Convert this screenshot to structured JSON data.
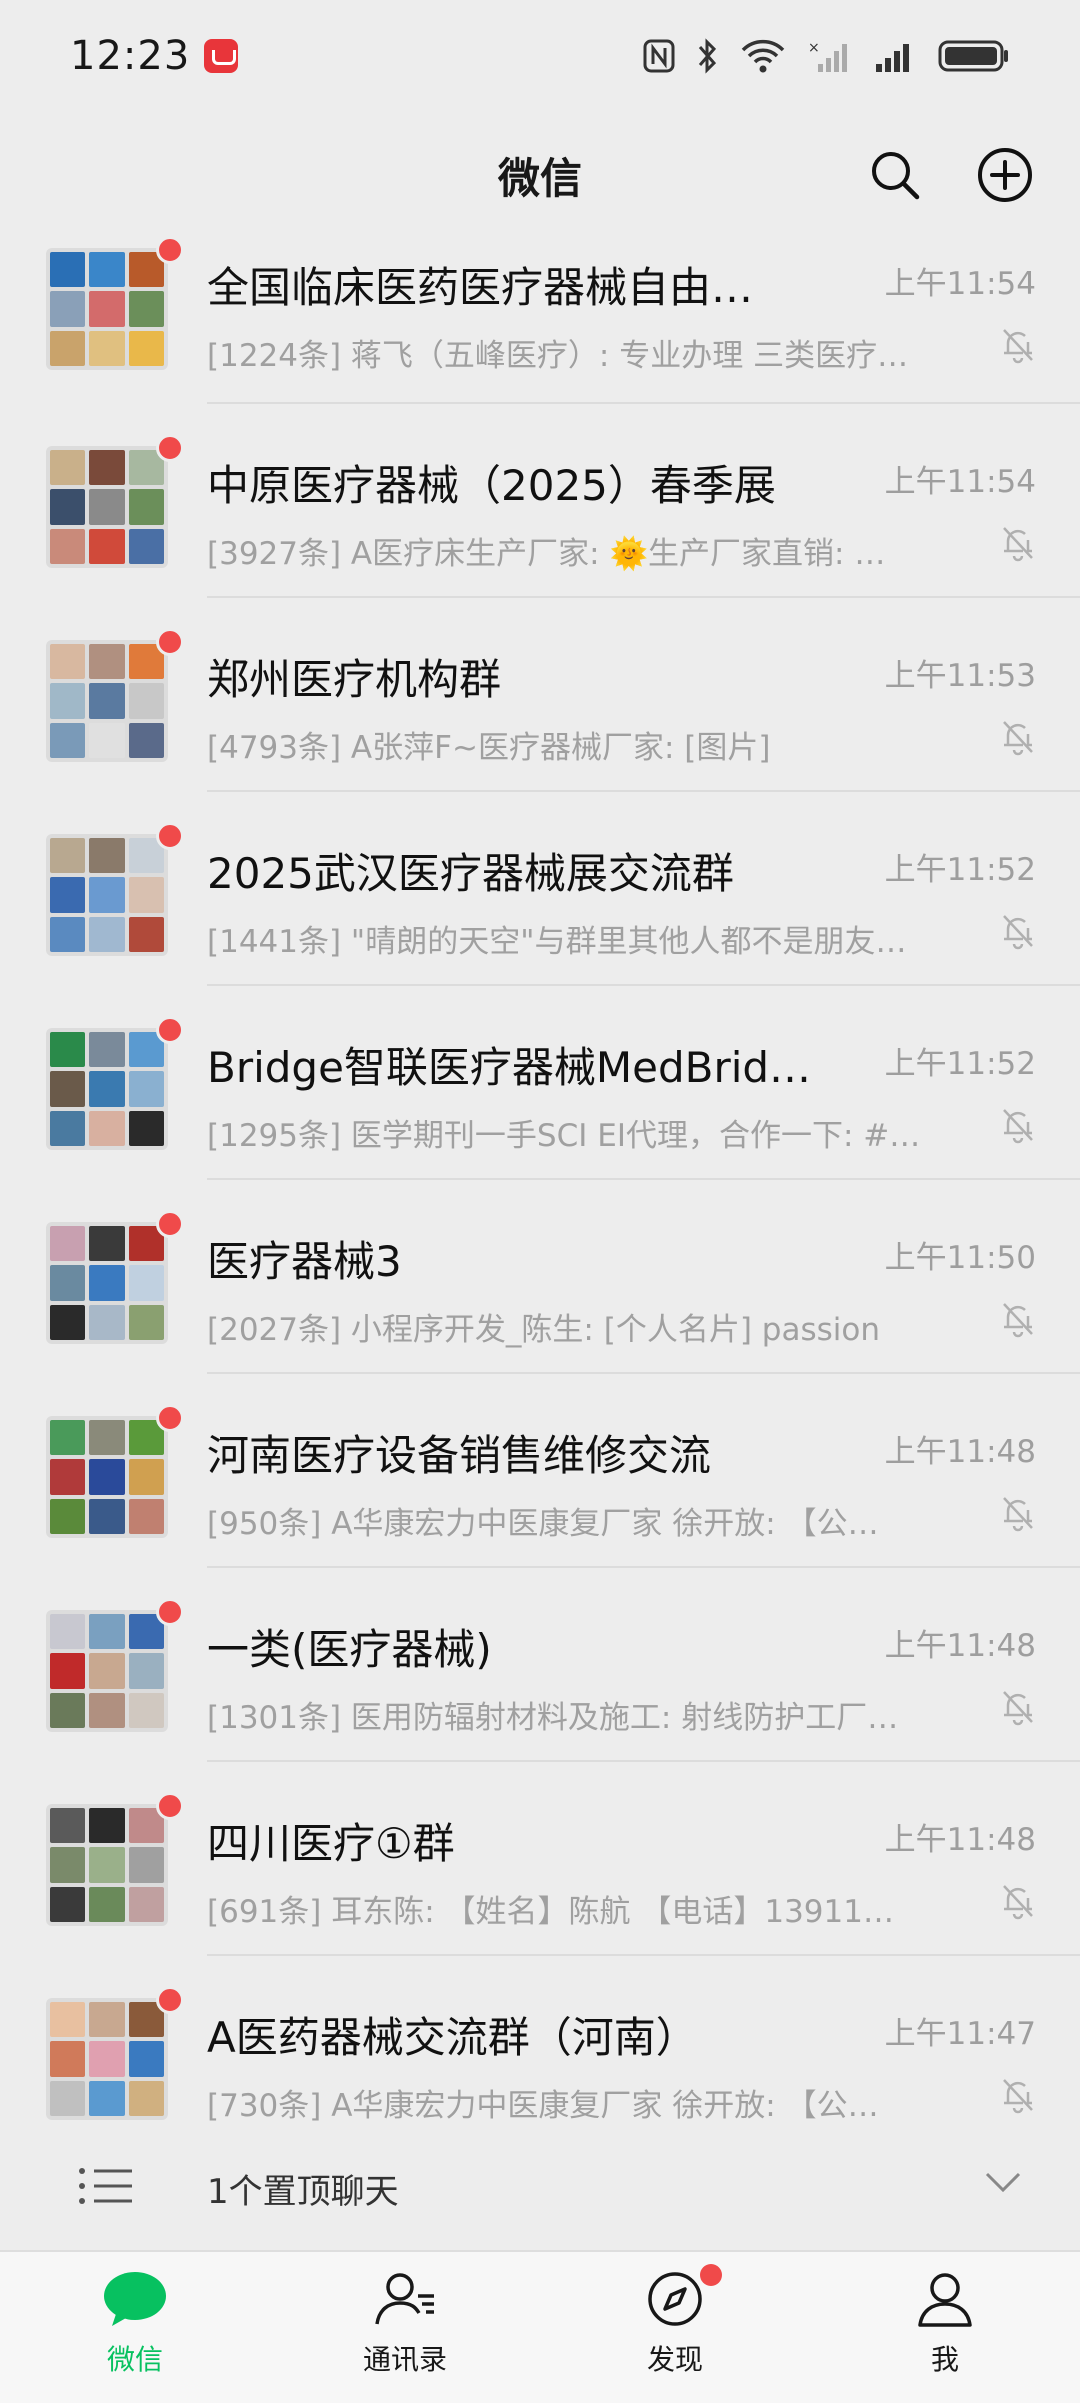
{
  "status_bar": {
    "time": "12:23"
  },
  "header": {
    "title": "微信"
  },
  "chats": [
    {
      "name": "全国临床医药医疗器械自由…",
      "time": "上午11:54",
      "preview": "[1224条] 蒋飞（五峰医疗）: 专业办理 三类医疗…",
      "avatar_colors": [
        "#2a6fb5",
        "#3a86c9",
        "#b85a2a",
        "#8aa0b8",
        "#d36b6b",
        "#6b8f5a",
        "#c9a36b",
        "#e0c080",
        "#e9b84a"
      ]
    },
    {
      "name": "中原医疗器械（2025）春季展",
      "time": "上午11:54",
      "preview": "[3927条] A医疗床生产厂家: 🌞生产厂家直销: …",
      "avatar_colors": [
        "#c9b08a",
        "#7a4a3a",
        "#a7b8a0",
        "#3b4f6b",
        "#8a8a8a",
        "#6b8f5a",
        "#c98a7a",
        "#d04a3a",
        "#4a6fa5"
      ]
    },
    {
      "name": "郑州医疗机构群",
      "time": "上午11:53",
      "preview": "[4793条] A张萍F~医疗器械厂家: [图片]",
      "avatar_colors": [
        "#d8b8a0",
        "#b09080",
        "#e07a3a",
        "#a0b8c8",
        "#5a7aa0",
        "#c8c8c8",
        "#7a9ab8",
        "#e0e0e0",
        "#5a6a8a"
      ]
    },
    {
      "name": "2025武汉医疗器械展交流群",
      "time": "上午11:52",
      "preview": "[1441条] \"晴朗的天空\"与群里其他人都不是朋友…",
      "avatar_colors": [
        "#b8a890",
        "#8a7a6a",
        "#c8d0d8",
        "#3a6ab0",
        "#6a9ad0",
        "#d8c0b0",
        "#5a8ac0",
        "#a0b8d0",
        "#b04a3a"
      ]
    },
    {
      "name": "Bridge智联医疗器械MedBrid…",
      "time": "上午11:52",
      "preview": "[1295条] 医学期刊一手SCI EI代理，合作一下: #…",
      "avatar_colors": [
        "#2a8a4a",
        "#7a8a9a",
        "#5a9ad0",
        "#6a5a4a",
        "#3a7ab0",
        "#8ab0d0",
        "#4a7aa0",
        "#d8b0a0",
        "#2a2a2a"
      ]
    },
    {
      "name": "医疗器械3",
      "time": "上午11:50",
      "preview": "[2027条] 小程序开发_陈生: [个人名片] passion",
      "avatar_colors": [
        "#c8a0b0",
        "#3a3a3a",
        "#b0302a",
        "#6a8aa0",
        "#3a7ac0",
        "#c0d0e0",
        "#2a2a2a",
        "#a8b8c8",
        "#8aa070"
      ]
    },
    {
      "name": "河南医疗设备销售维修交流",
      "time": "上午11:48",
      "preview": "[950条] A华康宏力中医康复厂家   徐开放: 【公…",
      "avatar_colors": [
        "#4a9a5a",
        "#8a8a7a",
        "#5a9a3a",
        "#b03a3a",
        "#2a4a9a",
        "#d0a050",
        "#5a8a3a",
        "#3a5a8a",
        "#c08070"
      ]
    },
    {
      "name": "一类(医疗器械)",
      "time": "上午11:48",
      "preview": "[1301条] 医用防辐射材料及施工: 射线防护工厂…",
      "avatar_colors": [
        "#c8c8d0",
        "#7aa0c0",
        "#3a6ab0",
        "#c02a2a",
        "#c8a890",
        "#9ab0c0",
        "#6a7a5a",
        "#b09080",
        "#d0c8c0"
      ]
    },
    {
      "name": "四川医疗①群",
      "time": "上午11:48",
      "preview": "[691条] 耳东陈: 【姓名】陈航  【电话】13911…",
      "avatar_colors": [
        "#5a5a5a",
        "#2a2a2a",
        "#c08a8a",
        "#7a8a6a",
        "#9ab08a",
        "#a0a0a0",
        "#3a3a3a",
        "#6a8a5a",
        "#c0a0a0"
      ]
    },
    {
      "name": "A医药器械交流群（河南）",
      "time": "上午11:47",
      "preview": "[730条] A华康宏力中医康复厂家   徐开放: 【公…",
      "avatar_colors": [
        "#e8c0a0",
        "#c8a890",
        "#8a5a3a",
        "#d07a5a",
        "#e0a0b0",
        "#3a7ac0",
        "#c0c0c0",
        "#5a9ad0",
        "#d0b080"
      ]
    }
  ],
  "pinned": {
    "label": "1个置顶聊天"
  },
  "nav": {
    "chats": "微信",
    "contacts": "通讯录",
    "discover": "发现",
    "me": "我",
    "active_color": "#07c160"
  }
}
